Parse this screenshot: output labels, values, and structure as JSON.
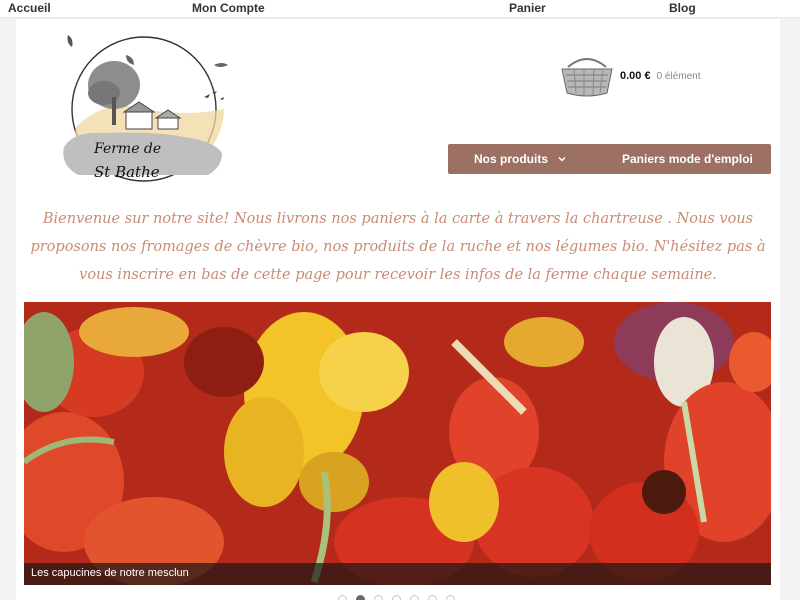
{
  "topnav": {
    "items": [
      "Accueil",
      "Mon Compte",
      "Panier",
      "Blog"
    ]
  },
  "logo": {
    "text_line1": "Ferme de",
    "text_line2": "St Bathe"
  },
  "cart": {
    "total": "0.00 €",
    "count": "0 élément",
    "icon": "basket-icon"
  },
  "menu": {
    "products_label": "Nos produits",
    "paniers_label": "Paniers mode d'emploi",
    "color": "#9c7063"
  },
  "welcome": {
    "text": "Bienvenue sur notre site! Nous livrons nos paniers à la carte à travers la chartreuse . Nous vous proposons nos fromages de chèvre bio, nos produits de la ruche et nos légumes bio. N'hésitez pas à vous inscrire en bas de cette page pour recevoir les infos de la ferme chaque semaine."
  },
  "slider": {
    "caption": "Les capucines de notre mesclun",
    "slide_count": 7,
    "active_slide": 2
  }
}
